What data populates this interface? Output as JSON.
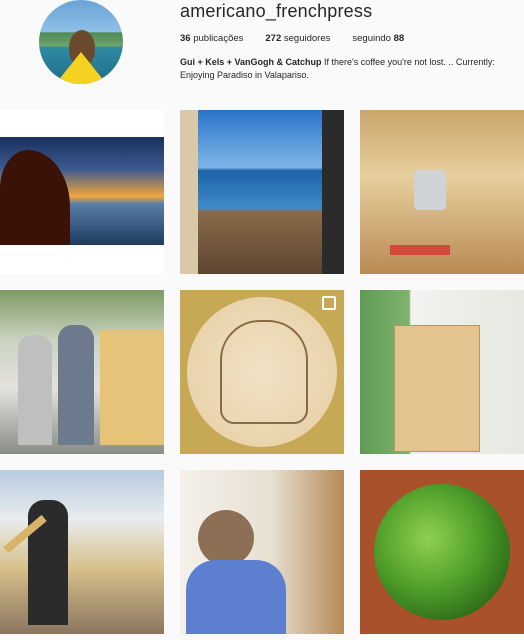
{
  "profile": {
    "username": "americano_frenchpress",
    "stats": {
      "posts_count": "36",
      "posts_label": "publicações",
      "followers_count": "272",
      "followers_label": "seguidores",
      "following_label": "seguindo",
      "following_count": "88"
    },
    "bio": {
      "name": "Gui + Kels + VanGogh & Catchup",
      "text": "If there's coffee you're not lost. .. Currently: Enjoying Paradiso in Valapariso."
    }
  },
  "posts": [
    {
      "icon": "sunset-silhouette-photo"
    },
    {
      "icon": "coastline-photo"
    },
    {
      "icon": "van-interior-photo"
    },
    {
      "icon": "people-van-photo"
    },
    {
      "icon": "carved-plate-photo",
      "multi": "multiple-images-icon"
    },
    {
      "icon": "cabinet-photo"
    },
    {
      "icon": "builder-photo"
    },
    {
      "icon": "woman-van-photo"
    },
    {
      "icon": "peppers-bowl-photo"
    }
  ]
}
